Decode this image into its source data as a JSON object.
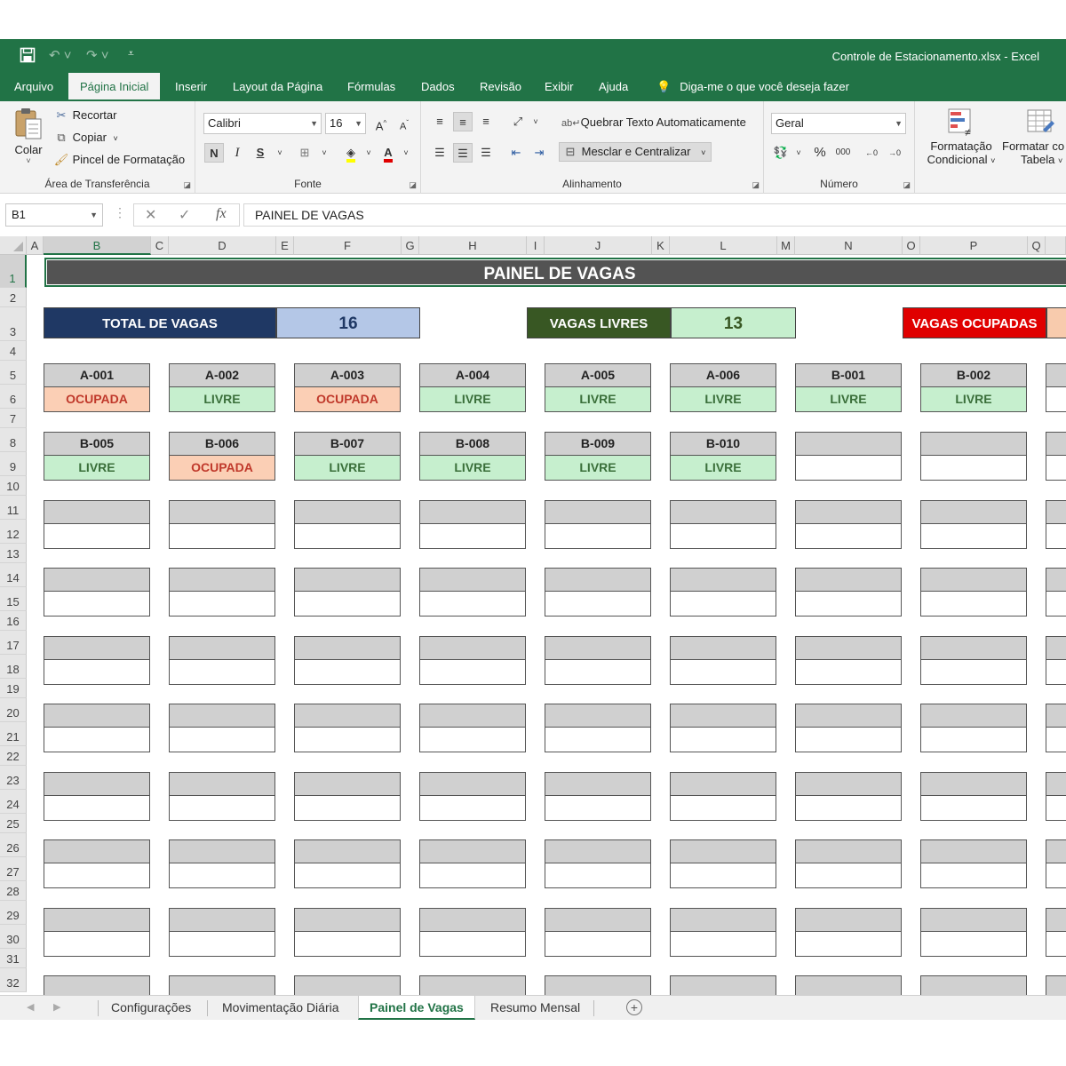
{
  "window": {
    "title": "Controle de Estacionamento.xlsx  -  Excel"
  },
  "ribbon": {
    "tabs": [
      "Arquivo",
      "Página Inicial",
      "Inserir",
      "Layout da Página",
      "Fórmulas",
      "Dados",
      "Revisão",
      "Exibir",
      "Ajuda"
    ],
    "active_tab": "Página Inicial",
    "tell_me": "Diga-me o que você deseja fazer",
    "clipboard": {
      "paste": "Colar",
      "cut": "Recortar",
      "copy": "Copiar",
      "format_painter": "Pincel de Formatação",
      "label": "Área de Transferência"
    },
    "font": {
      "name": "Calibri",
      "size": "16",
      "bold": "N",
      "italic": "I",
      "underline": "S",
      "label": "Fonte"
    },
    "alignment": {
      "wrap": "Quebrar Texto Automaticamente",
      "merge": "Mesclar e Centralizar",
      "label": "Alinhamento"
    },
    "number": {
      "format": "Geral",
      "label": "Número"
    },
    "styles": {
      "conditional_1": "Formatação",
      "conditional_2": "Condicional",
      "table_1": "Formatar co",
      "table_2": "Tabela"
    }
  },
  "formula_bar": {
    "name_box": "B1",
    "content": "PAINEL DE VAGAS"
  },
  "columns": [
    "A",
    "B",
    "C",
    "D",
    "E",
    "F",
    "G",
    "H",
    "I",
    "J",
    "K",
    "L",
    "M",
    "N",
    "O",
    "P",
    "Q"
  ],
  "rows": [
    "1",
    "2",
    "3",
    "4",
    "5",
    "6",
    "7",
    "8",
    "9",
    "10",
    "11",
    "12",
    "13",
    "14",
    "15",
    "16",
    "17",
    "18",
    "19",
    "20",
    "21",
    "22",
    "23",
    "24",
    "25",
    "26",
    "27",
    "28",
    "29",
    "30",
    "31",
    "32"
  ],
  "selected_cell": "B1",
  "panel": {
    "title": "PAINEL DE VAGAS",
    "total_label": "TOTAL DE VAGAS",
    "total_value": "16",
    "free_label": "VAGAS LIVRES",
    "free_value": "13",
    "occupied_label": "VAGAS OCUPADAS"
  },
  "spots": [
    {
      "code": "A-001",
      "status": "OCUPADA"
    },
    {
      "code": "A-002",
      "status": "LIVRE"
    },
    {
      "code": "A-003",
      "status": "OCUPADA"
    },
    {
      "code": "A-004",
      "status": "LIVRE"
    },
    {
      "code": "A-005",
      "status": "LIVRE"
    },
    {
      "code": "A-006",
      "status": "LIVRE"
    },
    {
      "code": "B-001",
      "status": "LIVRE"
    },
    {
      "code": "B-002",
      "status": "LIVRE"
    },
    {
      "code": "B-005",
      "status": "LIVRE"
    },
    {
      "code": "B-006",
      "status": "OCUPADA"
    },
    {
      "code": "B-007",
      "status": "LIVRE"
    },
    {
      "code": "B-008",
      "status": "LIVRE"
    },
    {
      "code": "B-009",
      "status": "LIVRE"
    },
    {
      "code": "B-010",
      "status": "LIVRE"
    }
  ],
  "sheet_tabs": [
    "Configurações",
    "Movimentação Diária",
    "Painel de Vagas",
    "Resumo Mensal"
  ],
  "active_sheet": "Painel de Vagas",
  "colors": {
    "excel_green": "#217346",
    "title_bg": "#535353",
    "total_bg": "#1f3864",
    "total_val_bg": "#b4c7e7",
    "free_bg": "#385723",
    "free_val_bg": "#c6efce",
    "occupied_bg": "#e00000",
    "occupied_val_bg": "#f8cbad",
    "free_text": "#3a6f3a",
    "busy_text": "#c0392b"
  },
  "icons": [
    "save-icon",
    "undo-icon",
    "redo-icon",
    "customize-qat-icon",
    "lightbulb-icon",
    "paste-icon",
    "scissors-icon",
    "copy-icon",
    "paintbrush-icon",
    "bold-icon",
    "italic-icon",
    "underline-icon",
    "borders-icon",
    "fill-color-icon",
    "font-color-icon",
    "align-icon",
    "orientation-icon",
    "indent-icon",
    "wrap-text-icon",
    "merge-icon",
    "currency-icon",
    "percent-icon",
    "comma-icon",
    "decimal-icon",
    "conditional-format-icon",
    "format-table-icon",
    "cancel-icon",
    "enter-icon",
    "fx-icon",
    "add-sheet-icon"
  ]
}
